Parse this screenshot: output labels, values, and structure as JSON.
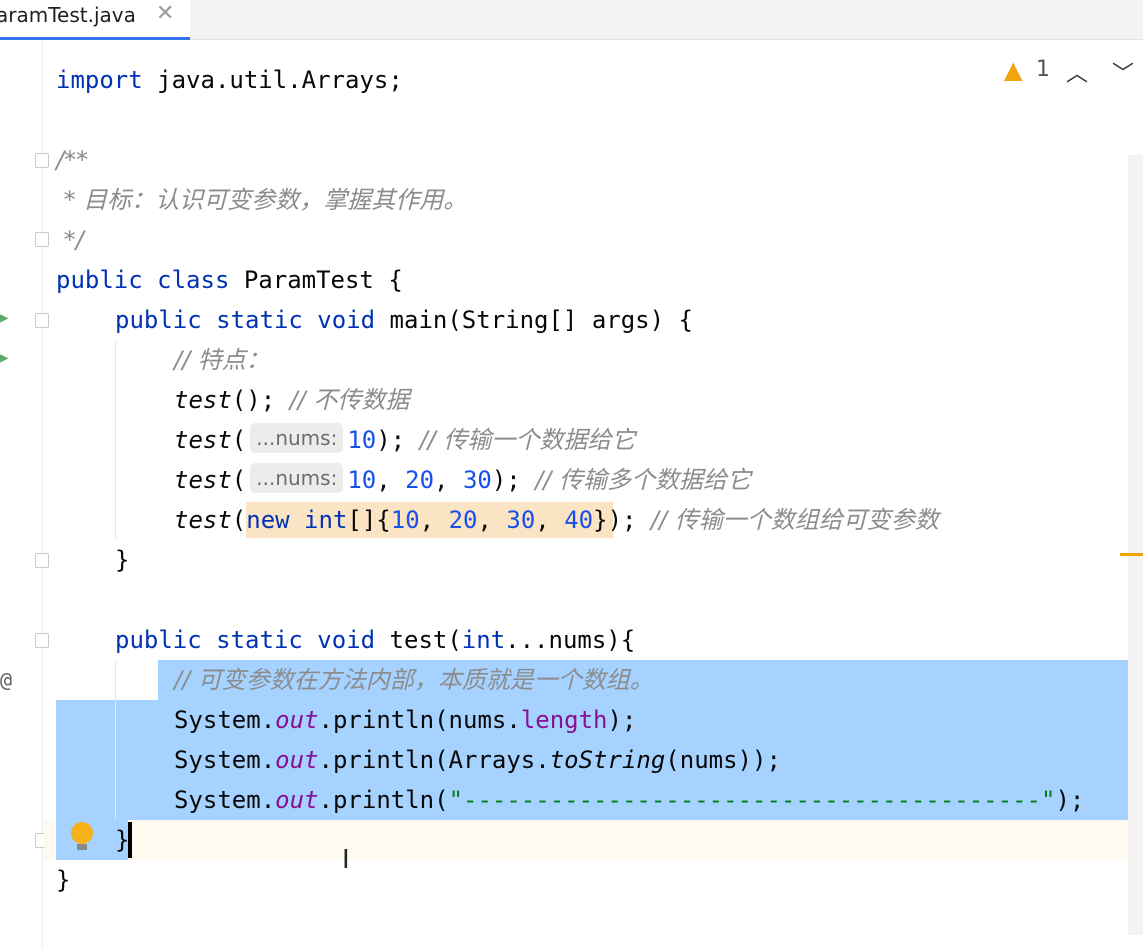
{
  "tab": {
    "file_name": "aramTest.java",
    "close_glyph": "✕"
  },
  "inspections": {
    "warning_count": "1",
    "icon": "warning-icon"
  },
  "code": {
    "line1": {
      "kw": "import",
      "rest": " java.util.Arrays;"
    },
    "line2": {
      "text": "/**"
    },
    "line3": {
      "text": " * 目标：认识可变参数，掌握其作用。"
    },
    "line4": {
      "text": " */"
    },
    "line5": {
      "kw": "public class",
      "rest": " ParamTest {"
    },
    "line6": {
      "kw": "public static void",
      "rest": " main(String[] args) {"
    },
    "line7": {
      "comment": "// 特点："
    },
    "line8": {
      "method": "test",
      "rest": "(); ",
      "comment": "// 不传数据"
    },
    "line9": {
      "method": "test",
      "open": "(",
      "hint": "...nums:",
      "num": "10",
      "close": "); ",
      "comment": "// 传输一个数据给它"
    },
    "line10": {
      "method": "test",
      "open": "(",
      "hint": "...nums:",
      "num1": "10",
      "sep1": ", ",
      "num2": "20",
      "sep2": ", ",
      "num3": "30",
      "close": "); ",
      "comment": "// 传输多个数据给它"
    },
    "line11": {
      "method": "test",
      "open": "(",
      "kw_new": "new",
      "kw_int": " int",
      "arr_open": "[]{",
      "n1": "10",
      "s1": ", ",
      "n2": "20",
      "s2": ", ",
      "n3": "30",
      "s3": ", ",
      "n4": "40",
      "arr_close": "}",
      "close": "); ",
      "comment": "// 传输一个数组给可变参数"
    },
    "line12": {
      "text": "}"
    },
    "line13": {
      "kw": "public static void",
      "mid": " test(",
      "kw2": "int",
      "rest": "...nums){"
    },
    "line14": {
      "comment": "// 可变参数在方法内部，本质就是一个数组。"
    },
    "line15": {
      "pre": "System.",
      "field": "out",
      "mid": ".println(nums.",
      "field2": "length",
      "post": ");"
    },
    "line16": {
      "pre": "System.",
      "field": "out",
      "mid": ".println(Arrays.",
      "method": "toString",
      "post": "(nums));"
    },
    "line17": {
      "pre": "System.",
      "field": "out",
      "mid": ".println(",
      "str": "\"----------------------------------------\"",
      "post": ");"
    },
    "line18": {
      "text": "}"
    },
    "line19": {
      "text": "}"
    }
  },
  "gutter": {
    "override_marker": "@"
  }
}
